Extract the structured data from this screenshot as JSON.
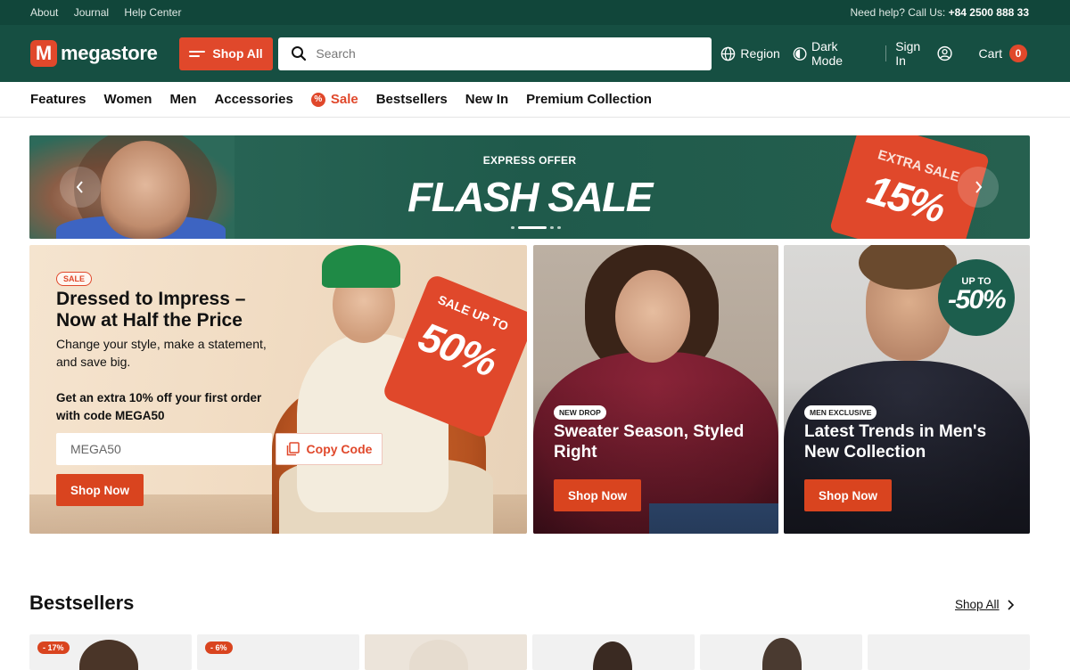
{
  "topbar": {
    "links": [
      "About",
      "Journal",
      "Help Center"
    ],
    "help_prefix": "Need help? Call Us: ",
    "phone": "+84 2500 888 33"
  },
  "header": {
    "logo_text": "megastore",
    "logo_mark": "M",
    "shop_all": "Shop All",
    "search_placeholder": "Search",
    "region": "Region",
    "dark_mode": "Dark Mode",
    "sign_in": "Sign In",
    "cart": "Cart",
    "cart_count": "0"
  },
  "categories": [
    "Features",
    "Women",
    "Men",
    "Accessories",
    "Sale",
    "Bestsellers",
    "New In",
    "Premium Collection"
  ],
  "flash": {
    "eyebrow": "EXPRESS OFFER",
    "title": "FLASH SALE",
    "tag_line": "EXTRA SALE",
    "tag_value": "15%",
    "active_slide": 2,
    "slide_count": 4
  },
  "promo_main": {
    "badge": "SALE",
    "title": "Dressed to Impress – Now at Half the Price",
    "subtitle": "Change your style, make a statement, and save big.",
    "extra": "Get an extra 10% off your first order with code MEGA50",
    "code": "MEGA50",
    "copy_label": "Copy Code",
    "cta": "Shop Now",
    "tag_line": "SALE UP TO",
    "tag_value": "50%"
  },
  "promo_cards": [
    {
      "badge": "NEW DROP",
      "title": "Sweater Season, Styled Right",
      "cta": "Shop Now"
    },
    {
      "badge": "MEN EXCLUSIVE",
      "title": "Latest Trends in Men's New Collection",
      "cta": "Shop Now",
      "circle_top": "UP TO",
      "circle_value": "-50%"
    }
  ],
  "bestsellers": {
    "title": "Bestsellers",
    "link": "Shop All",
    "tiles": [
      {
        "discount": "- 17%"
      },
      {
        "discount": "- 6%"
      },
      {
        "discount": ""
      },
      {
        "discount": ""
      },
      {
        "discount": ""
      },
      {
        "discount": ""
      }
    ]
  },
  "colors": {
    "brand_green": "#164f42",
    "accent": "#e0482b"
  }
}
